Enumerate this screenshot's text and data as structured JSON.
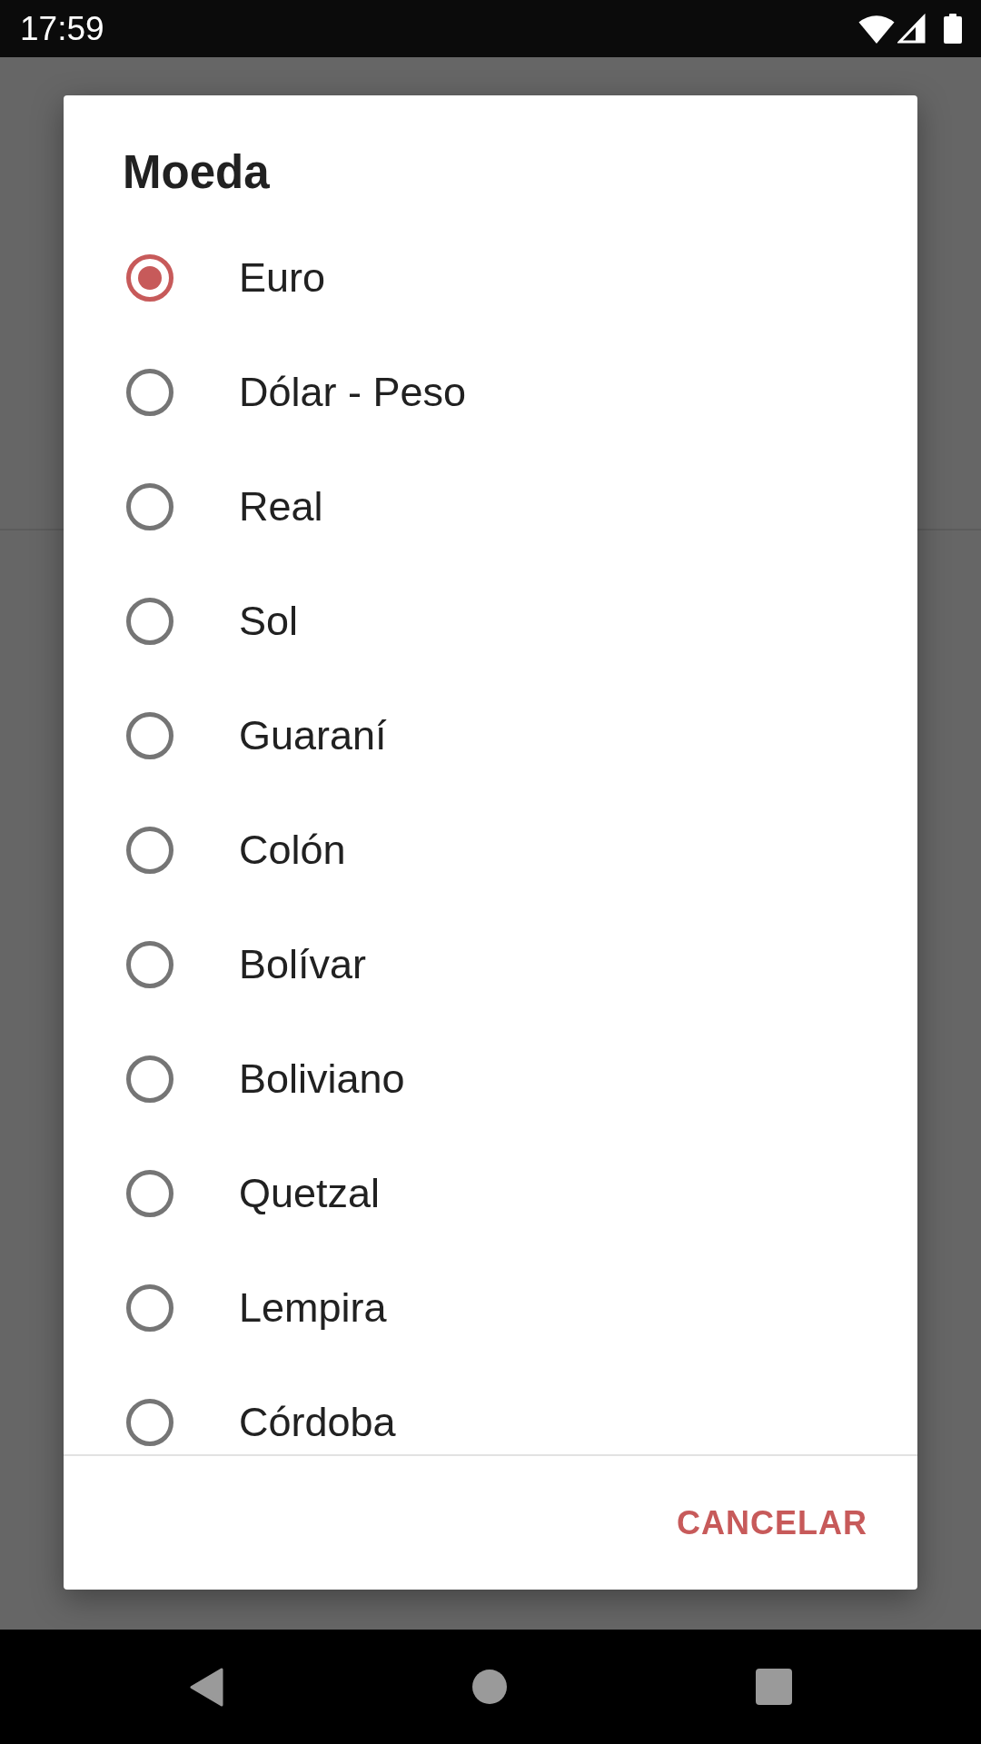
{
  "status_bar": {
    "time": "17:59"
  },
  "dialog": {
    "title": "Moeda",
    "options": [
      {
        "label": "Euro",
        "selected": true
      },
      {
        "label": "Dólar - Peso",
        "selected": false
      },
      {
        "label": "Real",
        "selected": false
      },
      {
        "label": "Sol",
        "selected": false
      },
      {
        "label": "Guaraní",
        "selected": false
      },
      {
        "label": "Colón",
        "selected": false
      },
      {
        "label": "Bolívar",
        "selected": false
      },
      {
        "label": "Boliviano",
        "selected": false
      },
      {
        "label": "Quetzal",
        "selected": false
      },
      {
        "label": "Lempira",
        "selected": false
      },
      {
        "label": "Córdoba",
        "selected": false
      }
    ],
    "buttons": [
      "CANCELAR"
    ]
  }
}
